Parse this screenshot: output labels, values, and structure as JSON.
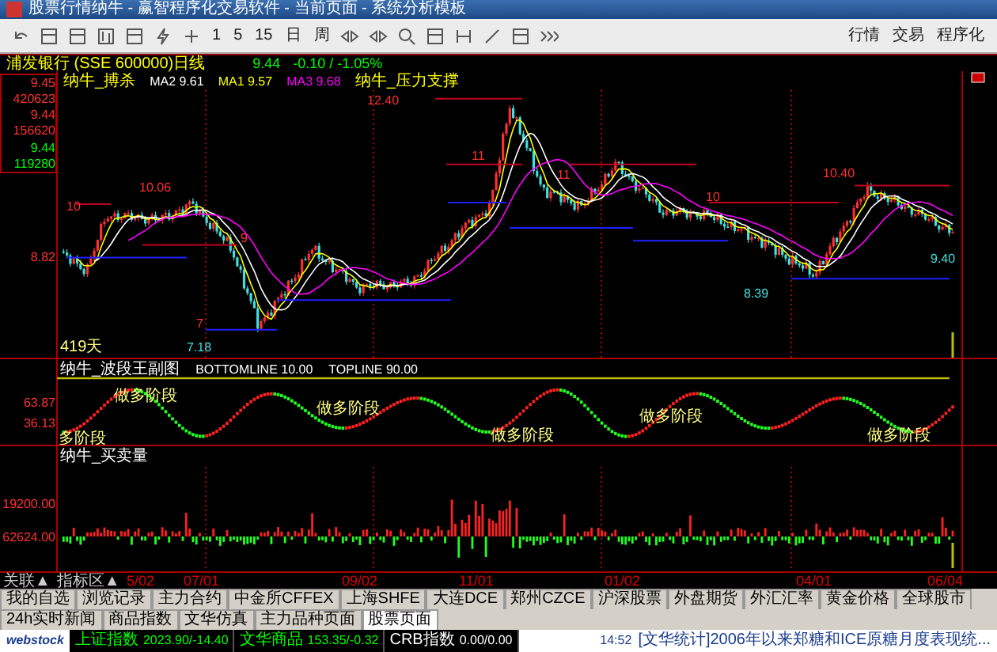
{
  "window": {
    "title": "股票行情纳牛 - 赢智程序化交易软件 - 当前页面 - 系统分析模板"
  },
  "toolbar": {
    "periods": [
      "1",
      "5",
      "15",
      "日",
      "周"
    ],
    "menus": [
      "行情",
      "交易",
      "程序化"
    ]
  },
  "quote": {
    "stock": "浦发银行 (SSE 600000)日线",
    "price": "9.44",
    "change": "-0.10 / -1.05%"
  },
  "legend": [
    {
      "text": "纳牛_搏杀",
      "color": "#ffff00"
    },
    {
      "text": "MA2 9.61",
      "color": "#ffffff"
    },
    {
      "text": "MA1 9.57",
      "color": "#ffff00"
    },
    {
      "text": "MA3 9.68",
      "color": "#ff00ff"
    },
    {
      "text": "纳牛_压力支撑",
      "color": "#ffff00"
    }
  ],
  "price_axis": [
    {
      "text": "9.45",
      "color": "#ff3030"
    },
    {
      "text": "420623",
      "color": "#ff3030"
    },
    {
      "text": "9.44",
      "color": "#ff3030"
    },
    {
      "text": "156620",
      "color": "#ff3030"
    },
    {
      "text": "9.44",
      "color": "#00ff00"
    },
    {
      "text": "119280",
      "color": "#00ff00"
    },
    {
      "text": "8.82",
      "color": "#ff3030"
    }
  ],
  "price_labels": [
    {
      "text": "10",
      "color": "#ff3030"
    },
    {
      "text": "10.06",
      "color": "#ff3030"
    },
    {
      "text": "9",
      "color": "#ff3030"
    },
    {
      "text": "7",
      "color": "#ff3030"
    },
    {
      "text": "7.18",
      "color": "#40e0e0"
    },
    {
      "text": "12.40",
      "color": "#ff3030"
    },
    {
      "text": "11",
      "color": "#ff3030"
    },
    {
      "text": "11",
      "color": "#ff3030"
    },
    {
      "text": "10",
      "color": "#ff3030"
    },
    {
      "text": "10.40",
      "color": "#ff3030"
    },
    {
      "text": "8.39",
      "color": "#40e0e0"
    },
    {
      "text": "9.40",
      "color": "#40e0e0"
    },
    {
      "text": "419天",
      "color": "#ffff80"
    }
  ],
  "oscillator": {
    "title": "纳牛_波段王副图",
    "bottomline": "BOTTOMLINE 10.00",
    "topline": "TOPLINE 90.00",
    "axis": [
      "63.87",
      "36.13"
    ],
    "stages": [
      "多阶段",
      "做多阶段",
      "做多阶段",
      "做多阶段",
      "做多阶段",
      "做多阶段"
    ]
  },
  "volume": {
    "title": "纳牛_买卖量",
    "axis": [
      "19200.00",
      "62624.00"
    ]
  },
  "date_axis": {
    "controls": [
      "关联▲",
      "指标区▲"
    ],
    "dates": [
      "5/02",
      "07/01",
      "09/02",
      "11/01",
      "01/02",
      "04/01",
      "06/04"
    ]
  },
  "tabs": [
    {
      "label": "我的自选",
      "selected": false
    },
    {
      "label": "浏览记录",
      "selected": false
    },
    {
      "label": "主力合约",
      "selected": false
    },
    {
      "label": "中金所CFFEX",
      "selected": false
    },
    {
      "label": "上海SHFE",
      "selected": false
    },
    {
      "label": "大连DCE",
      "selected": false
    },
    {
      "label": "郑州CZCE",
      "selected": false
    },
    {
      "label": "沪深股票",
      "selected": false
    },
    {
      "label": "外盘期货",
      "selected": false
    },
    {
      "label": "外汇汇率",
      "selected": false
    },
    {
      "label": "黄金价格",
      "selected": false
    },
    {
      "label": "全球股市",
      "selected": false
    },
    {
      "label": "24h实时新闻",
      "selected": false
    },
    {
      "label": "商品指数",
      "selected": false
    },
    {
      "label": "文华仿真",
      "selected": false
    },
    {
      "label": "主力品种页面",
      "selected": false
    },
    {
      "label": "股票页面",
      "selected": true
    }
  ],
  "status_bar": {
    "logo": "webstock",
    "indices": [
      {
        "name": "上证指数",
        "value": "2023.90/-14.40",
        "color": "#00ff00"
      },
      {
        "name": "文华商品",
        "value": "153.35/-0.32",
        "color": "#00ff00"
      },
      {
        "name": "CRB指数",
        "value": "0.00/0.00",
        "color": "#ffffff"
      }
    ],
    "time": "14:52",
    "news": "[文华统计]2006年以来郑糖和ICE原糖月度表现统..."
  }
}
